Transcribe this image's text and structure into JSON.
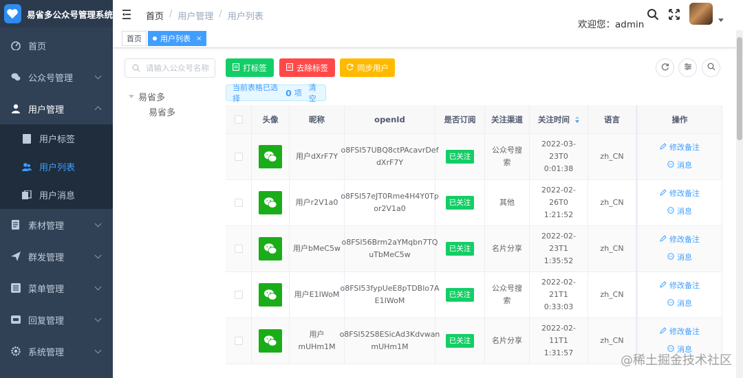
{
  "app": {
    "title": "易省多公众号管理系统"
  },
  "sidebar": {
    "items": [
      {
        "label": "首页",
        "icon": "dashboard-icon"
      },
      {
        "label": "公众号管理",
        "icon": "wechat-icon"
      },
      {
        "label": "用户管理",
        "icon": "user-icon",
        "open": true,
        "children": [
          {
            "label": "用户标签",
            "icon": "tag-icon"
          },
          {
            "label": "用户列表",
            "icon": "peoples-icon",
            "active": true
          },
          {
            "label": "用户消息",
            "icon": "message-icon"
          }
        ]
      },
      {
        "label": "素材管理",
        "icon": "material-icon"
      },
      {
        "label": "群发管理",
        "icon": "send-icon"
      },
      {
        "label": "菜单管理",
        "icon": "menu-icon"
      },
      {
        "label": "回复管理",
        "icon": "reply-icon"
      },
      {
        "label": "系统管理",
        "icon": "system-icon"
      }
    ]
  },
  "header": {
    "breadcrumb": [
      "首页",
      "用户管理",
      "用户列表"
    ],
    "welcome": "欢迎您：admin"
  },
  "tags": [
    {
      "label": "首页"
    },
    {
      "label": "用户列表",
      "active": true
    }
  ],
  "tree": {
    "search_placeholder": "请输入公众号名称",
    "root": "易省多",
    "child": "易省多"
  },
  "actions": {
    "tag": "打标签",
    "untag": "去除标签",
    "sync": "同步用户"
  },
  "selection": {
    "prefix": "当前表格已选择",
    "count": "0",
    "suffix": "项",
    "clear": "清 空"
  },
  "table": {
    "columns": [
      "头像",
      "昵称",
      "openId",
      "是否订阅",
      "关注渠道",
      "关注时间",
      "语言",
      "操作"
    ],
    "op_edit": "修改备注",
    "op_msg": "消息",
    "rows": [
      {
        "nick": "用户dXrF7Y",
        "openid_1": "o8FSI57UBQ8ctPAcavrDef",
        "openid_2": "dXrF7Y",
        "sub": "已关注",
        "ch_1": "公众号搜",
        "ch_2": "索",
        "time_1": "2022-03-23T0",
        "time_2": "0:01:38",
        "lang": "zh_CN"
      },
      {
        "nick": "用户r2V1a0",
        "openid_1": "o8FSI57eJT0Rme4H4Y0Tp",
        "openid_2": "or2V1a0",
        "sub": "已关注",
        "ch_1": "其他",
        "ch_2": "",
        "time_1": "2022-02-26T0",
        "time_2": "1:21:52",
        "lang": "zh_CN"
      },
      {
        "nick": "用户bMeC5w",
        "openid_1": "o8FSI56Brm2aYMqbn7TQ",
        "openid_2": "uTbMeC5w",
        "sub": "已关注",
        "ch_1": "名片分享",
        "ch_2": "",
        "time_1": "2022-02-23T1",
        "time_2": "1:35:52",
        "lang": "zh_CN"
      },
      {
        "nick": "用户E1IWoM",
        "openid_1": "o8FSI53fypUeE8pTDBlo7A",
        "openid_2": "E1IWoM",
        "sub": "已关注",
        "ch_1": "公众号搜",
        "ch_2": "索",
        "time_1": "2022-02-21T1",
        "time_2": "0:33:03",
        "lang": "zh_CN"
      },
      {
        "nick": "用户mUHm1M",
        "openid_1": "o8FSI52S8ESicAd3Kdvwan",
        "openid_2": "mUHm1M",
        "sub": "已关注",
        "ch_1": "名片分享",
        "ch_2": "",
        "time_1": "2022-02-11T1",
        "time_2": "1:31:57",
        "lang": "zh_CN"
      }
    ]
  },
  "watermark": "@稀土掘金技术社区",
  "colors": {
    "sidebar_bg": "#304156",
    "primary": "#409eff",
    "success": "#13ce66",
    "danger": "#ff4949",
    "warning": "#ffba00"
  }
}
